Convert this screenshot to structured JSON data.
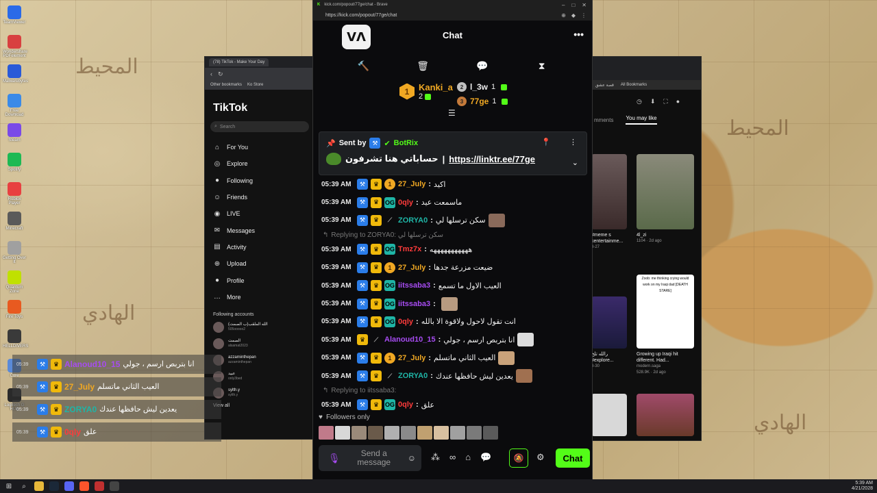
{
  "desktop": {
    "icons": [
      {
        "label": "TeamViewer"
      },
      {
        "label": "Wondershare PDFelement"
      },
      {
        "label": "Malwarebytes"
      },
      {
        "label": "Free Download"
      },
      {
        "label": "Steam"
      },
      {
        "label": "Spotify"
      },
      {
        "label": "Roblox Player"
      },
      {
        "label": "Minecraft"
      },
      {
        "label": "Getting Over It"
      },
      {
        "label": "Quantum Zone"
      },
      {
        "label": "Fire Toys"
      },
      {
        "label": "HELLDIVERS"
      },
      {
        "label": "Core"
      },
      {
        "label": "Logitech G HUB"
      }
    ]
  },
  "taskbar": {
    "time": "5:39 AM",
    "date": "4/21/2028"
  },
  "tiktok": {
    "tab_title": "(78) TikTok - Make Your Day",
    "bookmarks": [
      "Other bookmarks",
      "Ko Store"
    ],
    "logo": "TikTok",
    "search_placeholder": "Search",
    "nav": [
      {
        "label": "For You",
        "icon": "home-icon"
      },
      {
        "label": "Explore",
        "icon": "compass-icon"
      },
      {
        "label": "Following",
        "icon": "following-icon"
      },
      {
        "label": "Friends",
        "icon": "friends-icon"
      },
      {
        "label": "LIVE",
        "icon": "live-icon"
      },
      {
        "label": "Messages",
        "icon": "messages-icon"
      },
      {
        "label": "Activity",
        "icon": "activity-icon"
      },
      {
        "label": "Upload",
        "icon": "upload-icon"
      },
      {
        "label": "Profile",
        "icon": "profile-icon"
      },
      {
        "label": "More",
        "icon": "more-icon"
      }
    ],
    "following_header": "Following accounts",
    "accounts": [
      {
        "name": "الله الملقب(ب الصمت)",
        "handle": "505ooooo2"
      },
      {
        "name": "الصمت",
        "handle": "alsamat2023"
      },
      {
        "name": "azzaminthepan",
        "handle": "azzaminthepan"
      },
      {
        "name": "عبيد",
        "handle": "only3bed"
      },
      {
        "name": "sylth.y",
        "handle": "sylth.y"
      }
    ],
    "see_all": "View all"
  },
  "overlay": {
    "rows": [
      {
        "time": "05:39",
        "user": "Alanoud10_15",
        "user_color": "#a74cf2",
        "text": "انا بتربص ارسم ، جولي"
      },
      {
        "time": "05:39",
        "user": "27_July",
        "user_color": "#f0a823",
        "text": "العيب الثاني ماتسلم"
      },
      {
        "time": "05:39",
        "user": "ZORYA0",
        "user_color": "#1fb5a6",
        "text": "يعدين ليش حافظها عندك"
      },
      {
        "time": "05:39",
        "user": "0qly",
        "user_color": "#ff3b3b",
        "text": "علق"
      }
    ]
  },
  "right_browser": {
    "bookmarks": [
      "قصة عشق",
      "All Bookmarks"
    ],
    "tabs": [
      "mments",
      "You may like"
    ],
    "cards": [
      {
        "title": "#meme s",
        "sub": "kentertainme...",
        "meta": "3-27"
      },
      {
        "title": "4l_zi",
        "sub": "",
        "meta": "1104 · 2d ago"
      },
      {
        "title": "رالله تلخ",
        "sub": "#explore...",
        "meta": "3-30"
      },
      {
        "title": "Growing up Iraqi hit different. Had...",
        "sub": "modern.saga",
        "meta": "528.9K · 2d ago"
      }
    ],
    "thumb_caption": "Zoob: me thinking crying would work on my Iraqi dad [DEATH STARE]"
  },
  "chat": {
    "window_title": "kick.com/popout/77ge/chat - Brave",
    "url": "https://kick.com/popout/77ge/chat",
    "title": "Chat",
    "leaderboard": {
      "first": {
        "name": "Kanki_a",
        "count": "2",
        "rank": "1"
      },
      "second": {
        "name": "l_3w",
        "count": "1",
        "rank": "2"
      },
      "third": {
        "name": "77ge",
        "count": "1",
        "rank": "3"
      }
    },
    "pinned": {
      "sent_by": "Sent by",
      "bot": "BotRix",
      "text": "حساباتي هنا تشرفون",
      "separator": "|",
      "link": "https://linktr.ee/77ge"
    },
    "messages": [
      {
        "time": "05:39 AM",
        "user": "27_July",
        "color": "#f0a823",
        "text": "اكيد",
        "badges": [
          "mod",
          "vip",
          "sub"
        ]
      },
      {
        "time": "05:39 AM",
        "user": "0qly",
        "color": "#ff3b3b",
        "text": "ماسمعت عيد",
        "badges": [
          "mod",
          "vip",
          "og"
        ]
      },
      {
        "time": "05:39 AM",
        "user": "ZORYA0",
        "color": "#1fb5a6",
        "text": "سكن ترسلها لي",
        "badges": [
          "mod",
          "vip",
          "sword"
        ],
        "emote": "#8a6a5a"
      },
      {
        "reply": "Replying to ZORYA0: سكن ترسلها لي"
      },
      {
        "time": "05:39 AM",
        "user": "Tmz7x",
        "color": "#ff3b3b",
        "text": "هههههههههههه",
        "badges": [
          "mod",
          "vip",
          "og"
        ]
      },
      {
        "time": "05:39 AM",
        "user": "27_July",
        "color": "#f0a823",
        "text": "ضيعت مزرعة جدها",
        "badges": [
          "mod",
          "vip",
          "sub"
        ]
      },
      {
        "time": "05:39 AM",
        "user": "iitssaba3",
        "color": "#a74cf2",
        "text": "العيب الاول ما تسمع",
        "badges": [
          "mod",
          "vip",
          "og"
        ]
      },
      {
        "time": "05:39 AM",
        "user": "iitssaba3",
        "color": "#a74cf2",
        "text": "",
        "badges": [
          "mod",
          "vip",
          "og"
        ],
        "emote": "#b79a80"
      },
      {
        "time": "05:39 AM",
        "user": "0qly",
        "color": "#ff3b3b",
        "text": "انت تقول لاحول ولاقوة الا بالله",
        "badges": [
          "mod",
          "vip",
          "og"
        ]
      },
      {
        "time": "05:39 AM",
        "user": "Alanoud10_15",
        "color": "#a74cf2",
        "text": "انا بتربص ارسم ، جولي",
        "badges": [
          "vip",
          "sword"
        ],
        "emote": "#dcdcdc"
      },
      {
        "time": "05:39 AM",
        "user": "27_July",
        "color": "#f0a823",
        "text": "العيب الثاني ماتسلم",
        "badges": [
          "mod",
          "vip",
          "sub"
        ],
        "emote": "#c9a27a"
      },
      {
        "time": "05:39 AM",
        "user": "ZORYA0",
        "color": "#1fb5a6",
        "text": "يعدين ليش حافظها عندك",
        "badges": [
          "mod",
          "vip",
          "sword"
        ],
        "emote": "#a07050"
      },
      {
        "reply": "Replying to iitssaba3:"
      },
      {
        "time": "05:39 AM",
        "user": "0qly",
        "color": "#ff3b3b",
        "text": "علق",
        "badges": [
          "mod",
          "vip",
          "og"
        ]
      }
    ],
    "followers_only": "Followers only",
    "composer": {
      "placeholder": "Send a message",
      "send": "Chat"
    }
  }
}
